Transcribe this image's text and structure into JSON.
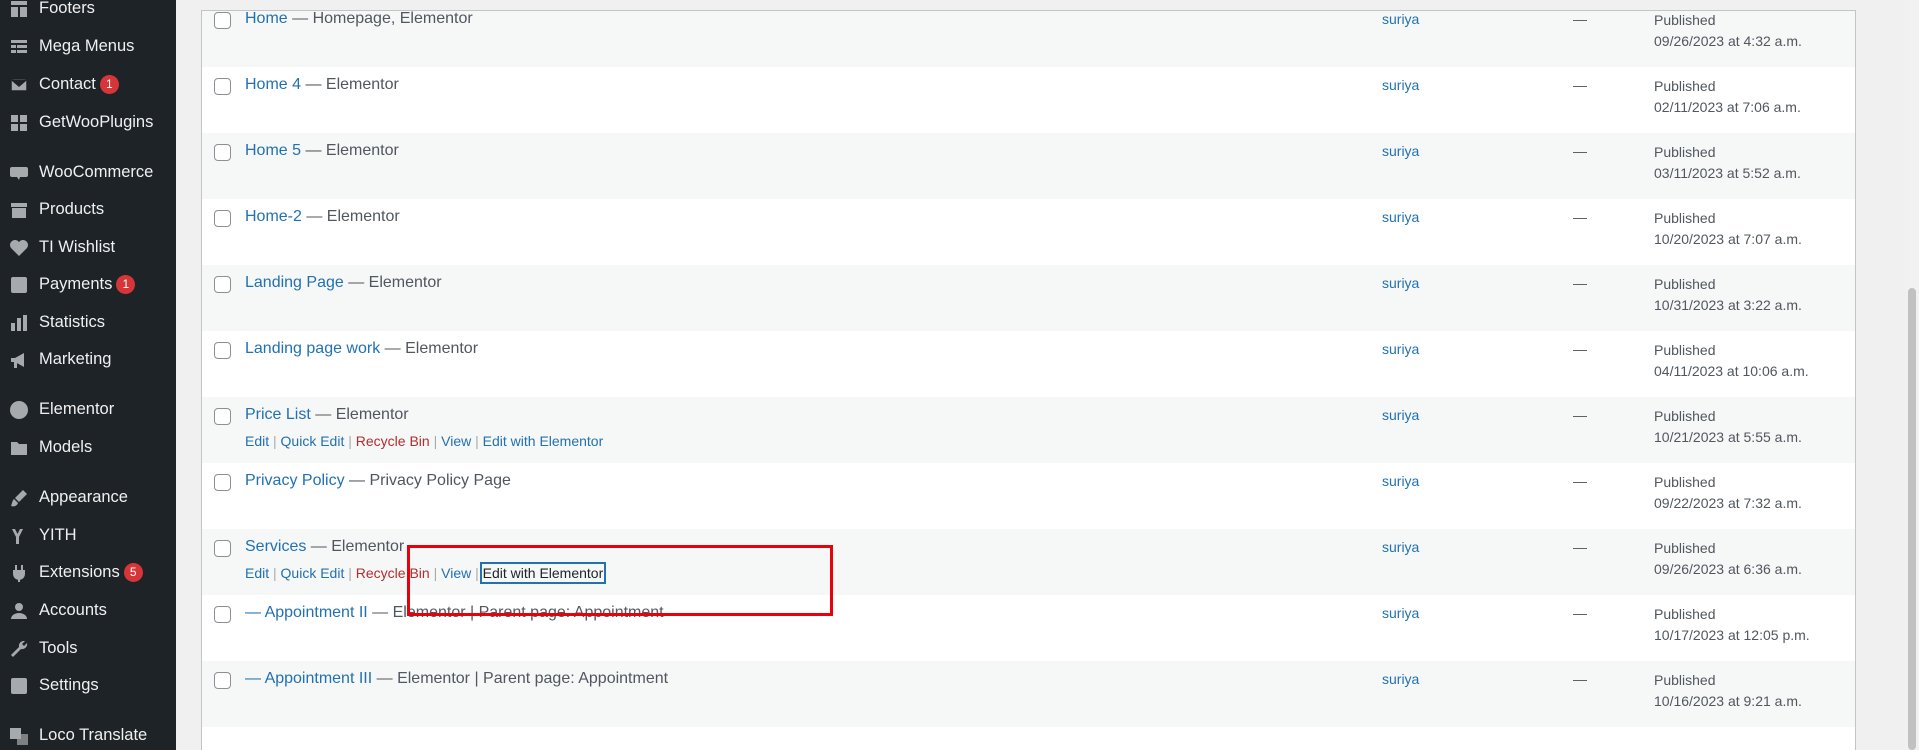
{
  "sidebar": {
    "items": [
      {
        "label": "Footers",
        "icon": "layout-icon",
        "badge": ""
      },
      {
        "label": "Mega Menus",
        "icon": "table-icon",
        "badge": ""
      },
      {
        "label": "Contact",
        "icon": "email-icon",
        "badge": "1"
      },
      {
        "label": "GetWooPlugins",
        "icon": "plugin-grid-icon",
        "badge": ""
      },
      {
        "label": "WooCommerce",
        "icon": "woo-icon",
        "badge": ""
      },
      {
        "label": "Products",
        "icon": "archive-icon",
        "badge": ""
      },
      {
        "label": "TI Wishlist",
        "icon": "heart-icon",
        "badge": ""
      },
      {
        "label": "Payments",
        "icon": "dollar-icon",
        "badge": "1"
      },
      {
        "label": "Statistics",
        "icon": "chart-bar-icon",
        "badge": ""
      },
      {
        "label": "Marketing",
        "icon": "megaphone-icon",
        "badge": ""
      },
      {
        "label": "Elementor",
        "icon": "elementor-icon",
        "badge": ""
      },
      {
        "label": "Models",
        "icon": "folder-icon",
        "badge": ""
      },
      {
        "label": "Appearance",
        "icon": "paintbrush-icon",
        "badge": ""
      },
      {
        "label": "YITH",
        "icon": "yith-icon",
        "badge": ""
      },
      {
        "label": "Extensions",
        "icon": "plugin-icon",
        "badge": "5"
      },
      {
        "label": "Accounts",
        "icon": "user-icon",
        "badge": ""
      },
      {
        "label": "Tools",
        "icon": "wrench-icon",
        "badge": ""
      },
      {
        "label": "Settings",
        "icon": "settings-icon",
        "badge": ""
      },
      {
        "label": "Loco Translate",
        "icon": "translate-icon",
        "badge": ""
      }
    ]
  },
  "rows": [
    {
      "title": "Home",
      "state": " — Homepage, Elementor",
      "author": "suriya",
      "comments": "—",
      "status": "Published",
      "date": "09/26/2023 at 4:32 a.m."
    },
    {
      "title": "Home 4",
      "state": " — Elementor",
      "author": "suriya",
      "comments": "—",
      "status": "Published",
      "date": "02/11/2023 at 7:06 a.m."
    },
    {
      "title": "Home 5",
      "state": " — Elementor",
      "author": "suriya",
      "comments": "—",
      "status": "Published",
      "date": "03/11/2023 at 5:52 a.m."
    },
    {
      "title": "Home-2",
      "state": " — Elementor",
      "author": "suriya",
      "comments": "—",
      "status": "Published",
      "date": "10/20/2023 at 7:07 a.m."
    },
    {
      "title": "Landing Page",
      "state": " — Elementor",
      "author": "suriya",
      "comments": "—",
      "status": "Published",
      "date": "10/31/2023 at 3:22 a.m."
    },
    {
      "title": "Landing page work",
      "state": " — Elementor",
      "author": "suriya",
      "comments": "—",
      "status": "Published",
      "date": "04/11/2023 at 10:06 a.m."
    },
    {
      "title": "Price List",
      "state": " — Elementor",
      "author": "suriya",
      "comments": "—",
      "status": "Published",
      "date": "10/21/2023 at 5:55 a.m."
    },
    {
      "title": "Privacy Policy",
      "state": " — Privacy Policy Page",
      "author": "suriya",
      "comments": "—",
      "status": "Published",
      "date": "09/22/2023 at 7:32 a.m."
    },
    {
      "title": "Services",
      "state": " — Elementor",
      "author": "suriya",
      "comments": "—",
      "status": "Published",
      "date": "09/26/2023 at 6:36 a.m."
    },
    {
      "title": "— Appointment II",
      "state": " — Elementor | Parent page: Appointment",
      "author": "suriya",
      "comments": "—",
      "status": "Published",
      "date": "10/17/2023 at 12:05 p.m."
    },
    {
      "title": "— Appointment III",
      "state": " — Elementor | Parent page: Appointment",
      "author": "suriya",
      "comments": "—",
      "status": "Published",
      "date": "10/16/2023 at 9:21 a.m."
    }
  ],
  "row_actions": {
    "edit": "Edit",
    "quick_edit": "Quick Edit",
    "trash": "Recycle Bin",
    "view": "View",
    "edit_elementor": "Edit with Elementor",
    "sep": " | "
  },
  "colors": {
    "sidebar_bg": "#1d2327",
    "link": "#2271b1",
    "trash": "#b32d2e",
    "badge": "#d63638",
    "highlight": "#e8000b"
  }
}
